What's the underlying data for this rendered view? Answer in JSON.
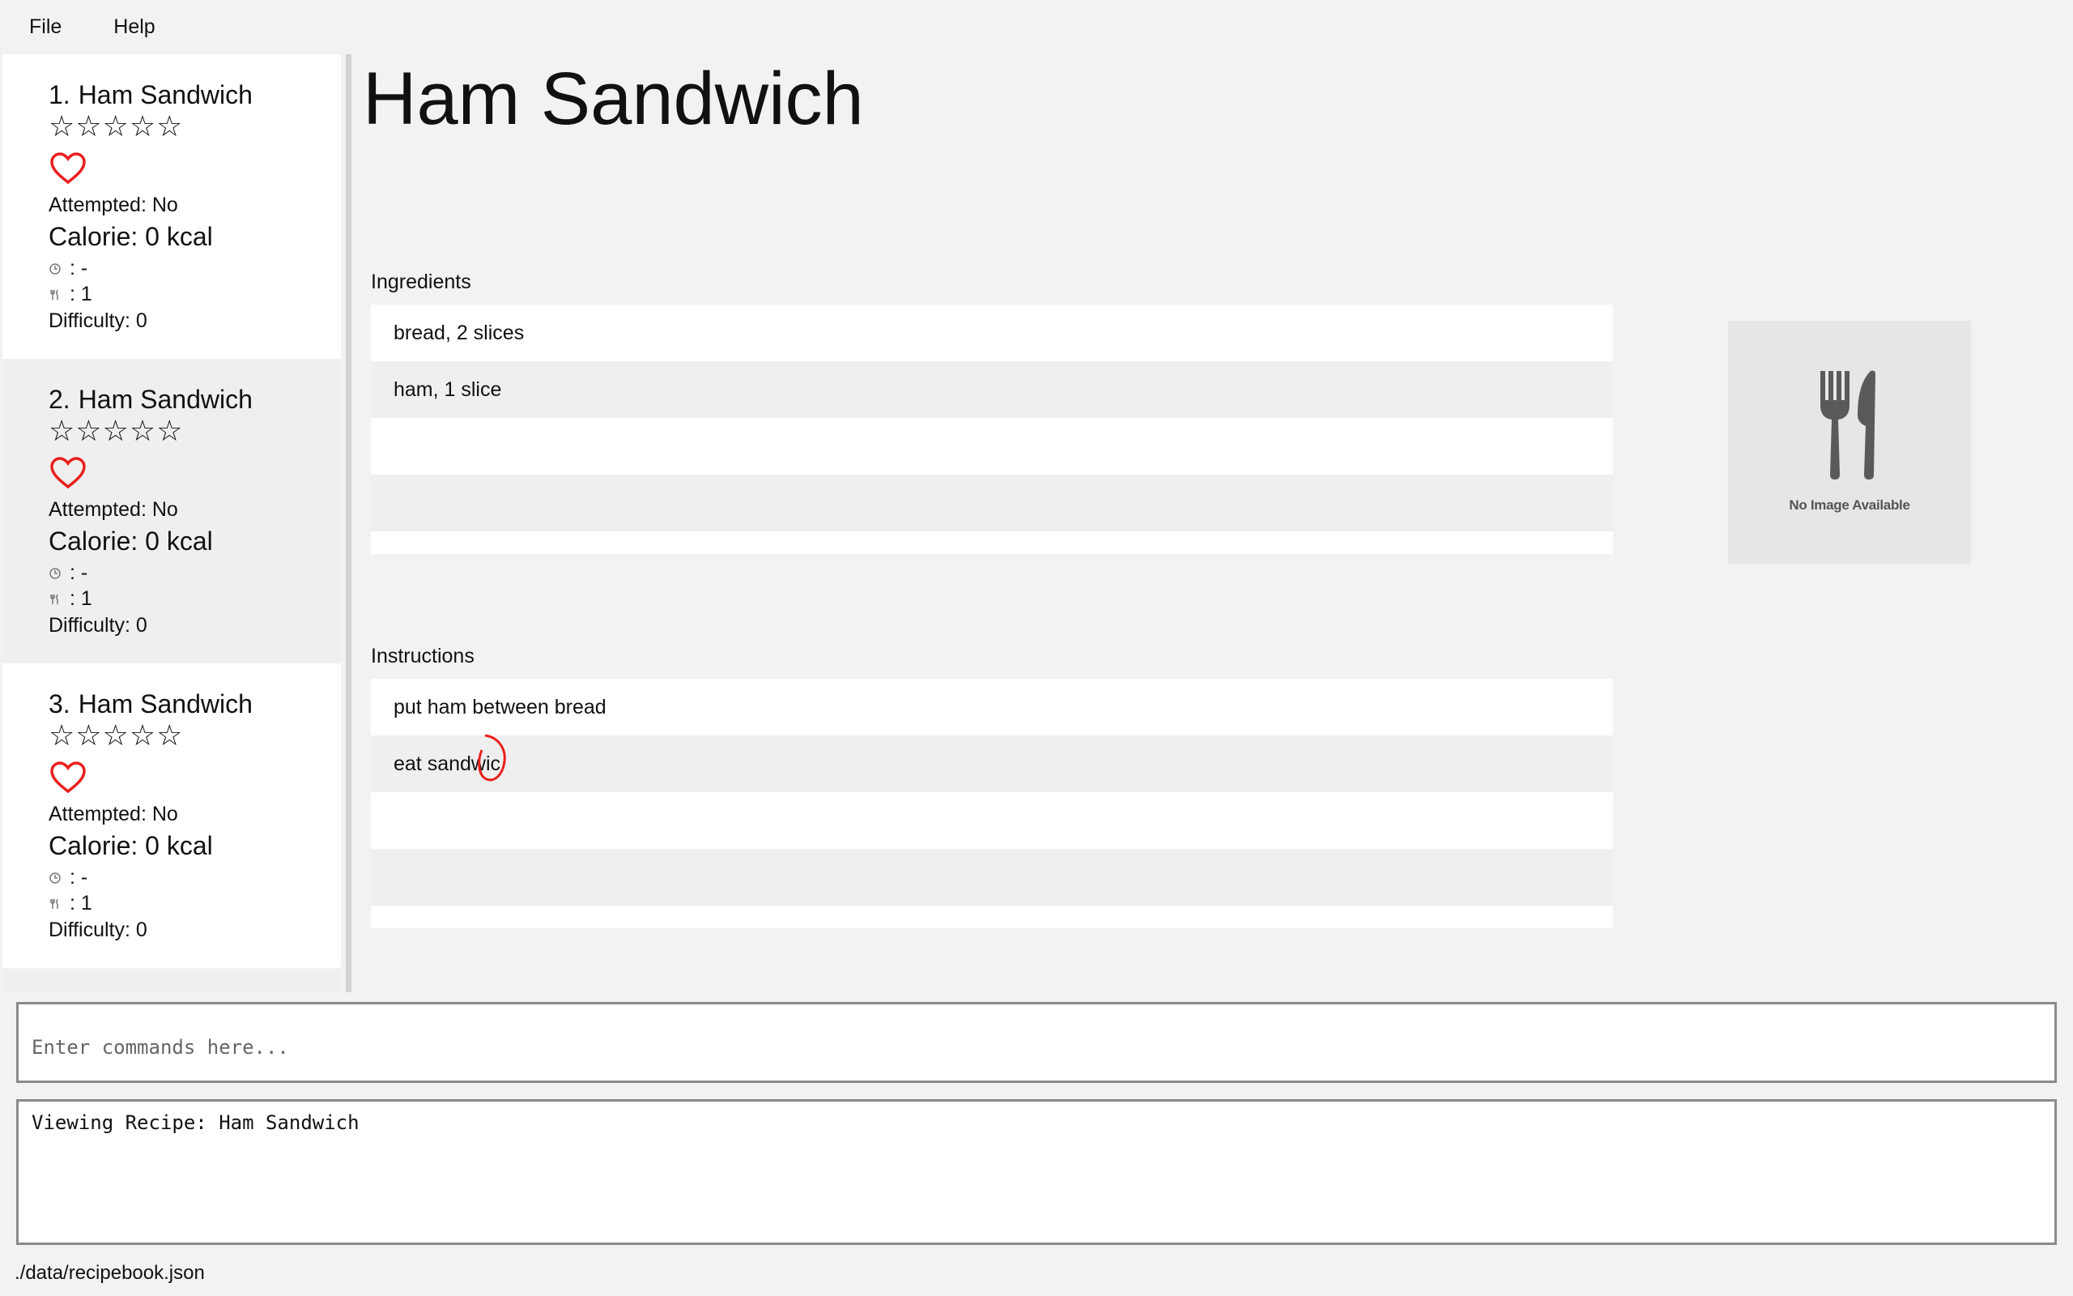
{
  "menu": {
    "file": "File",
    "help": "Help"
  },
  "recipes": [
    {
      "index": "1.",
      "name": "Ham Sandwich",
      "stars": "☆☆☆☆☆",
      "attempted": "Attempted: No",
      "calorie": "Calorie: 0 kcal",
      "time": ": -",
      "servings": ": 1",
      "difficulty": "Difficulty: 0"
    },
    {
      "index": "2.",
      "name": "Ham Sandwich",
      "stars": "☆☆☆☆☆",
      "attempted": "Attempted: No",
      "calorie": "Calorie: 0 kcal",
      "time": ": -",
      "servings": ": 1",
      "difficulty": "Difficulty: 0"
    },
    {
      "index": "3.",
      "name": "Ham Sandwich",
      "stars": "☆☆☆☆☆",
      "attempted": "Attempted: No",
      "calorie": "Calorie: 0 kcal",
      "time": ": -",
      "servings": ": 1",
      "difficulty": "Difficulty: 0"
    }
  ],
  "detail": {
    "title": "Ham Sandwich",
    "ingredients_label": "Ingredients",
    "ingredients": [
      "bread, 2 slices",
      "ham, 1 slice",
      "",
      ""
    ],
    "instructions_label": "Instructions",
    "instructions": [
      "put ham between bread",
      "eat sandwic",
      "",
      ""
    ],
    "no_image_label": "No Image Available"
  },
  "command": {
    "placeholder": "Enter commands here...",
    "value": ""
  },
  "result": {
    "text": "Viewing Recipe: Ham Sandwich"
  },
  "status": {
    "path": "./data/recipebook.json"
  },
  "icons": {
    "favourite": "heart-icon",
    "time": "clock-icon",
    "servings": "utensils-icon",
    "image_placeholder": "fork-knife-icon"
  },
  "colors": {
    "heart": "#e8201e",
    "background": "#f2f2f2",
    "annotation": "#e8201e"
  }
}
